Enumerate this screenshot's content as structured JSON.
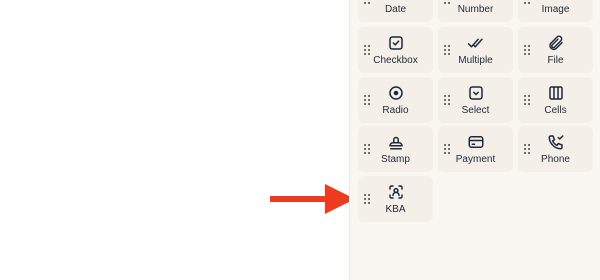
{
  "field_palette": {
    "items": [
      {
        "label": "Date",
        "icon": "calendar-icon"
      },
      {
        "label": "Number",
        "icon": "number-icon"
      },
      {
        "label": "Image",
        "icon": "image-icon"
      },
      {
        "label": "Checkbox",
        "icon": "checkbox-icon"
      },
      {
        "label": "Multiple",
        "icon": "double-check-icon"
      },
      {
        "label": "File",
        "icon": "paperclip-icon"
      },
      {
        "label": "Radio",
        "icon": "radio-icon"
      },
      {
        "label": "Select",
        "icon": "select-dropdown-icon"
      },
      {
        "label": "Cells",
        "icon": "cells-columns-icon"
      },
      {
        "label": "Stamp",
        "icon": "stamp-icon"
      },
      {
        "label": "Payment",
        "icon": "credit-card-icon"
      },
      {
        "label": "Phone",
        "icon": "phone-check-icon"
      },
      {
        "label": "KBA",
        "icon": "face-scan-icon"
      }
    ]
  },
  "annotation": {
    "arrow_color": "#ee3b1f",
    "points_to": "KBA"
  }
}
